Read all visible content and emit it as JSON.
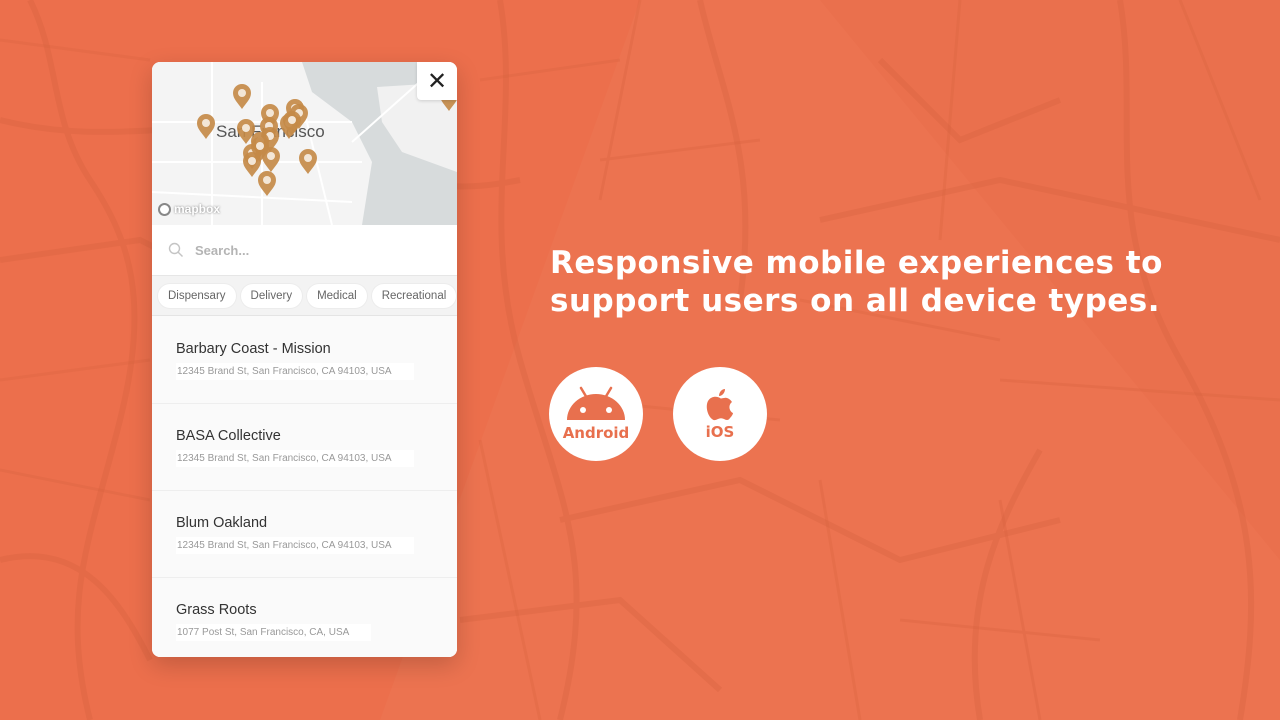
{
  "colors": {
    "background": "#EC6F4C",
    "pin": "#C48A48",
    "accent_text": "#E8704E"
  },
  "map": {
    "city_label": "San Francisco",
    "attribution": "mapbox",
    "close_icon": "close-icon",
    "pins_count": 18
  },
  "search": {
    "placeholder": "Search...",
    "value": "",
    "icon": "search-icon"
  },
  "filters": [
    {
      "label": "Dispensary"
    },
    {
      "label": "Delivery"
    },
    {
      "label": "Medical"
    },
    {
      "label": "Recreational"
    }
  ],
  "locations": [
    {
      "name": "Barbary Coast - Mission",
      "address": "12345 Brand St, San Francisco, CA 94103, USA"
    },
    {
      "name": "BASA Collective",
      "address": "12345 Brand St, San Francisco, CA 94103, USA"
    },
    {
      "name": "Blum Oakland",
      "address": "12345 Brand St, San Francisco, CA 94103, USA"
    },
    {
      "name": "Grass Roots",
      "address": "1077 Post St, San Francisco, CA, USA"
    }
  ],
  "headline": {
    "line1": "Responsive mobile experiences to",
    "line2": "support users on all device types."
  },
  "platforms": [
    {
      "label": "Android",
      "icon": "android-icon"
    },
    {
      "label": "iOS",
      "icon": "apple-icon"
    }
  ]
}
